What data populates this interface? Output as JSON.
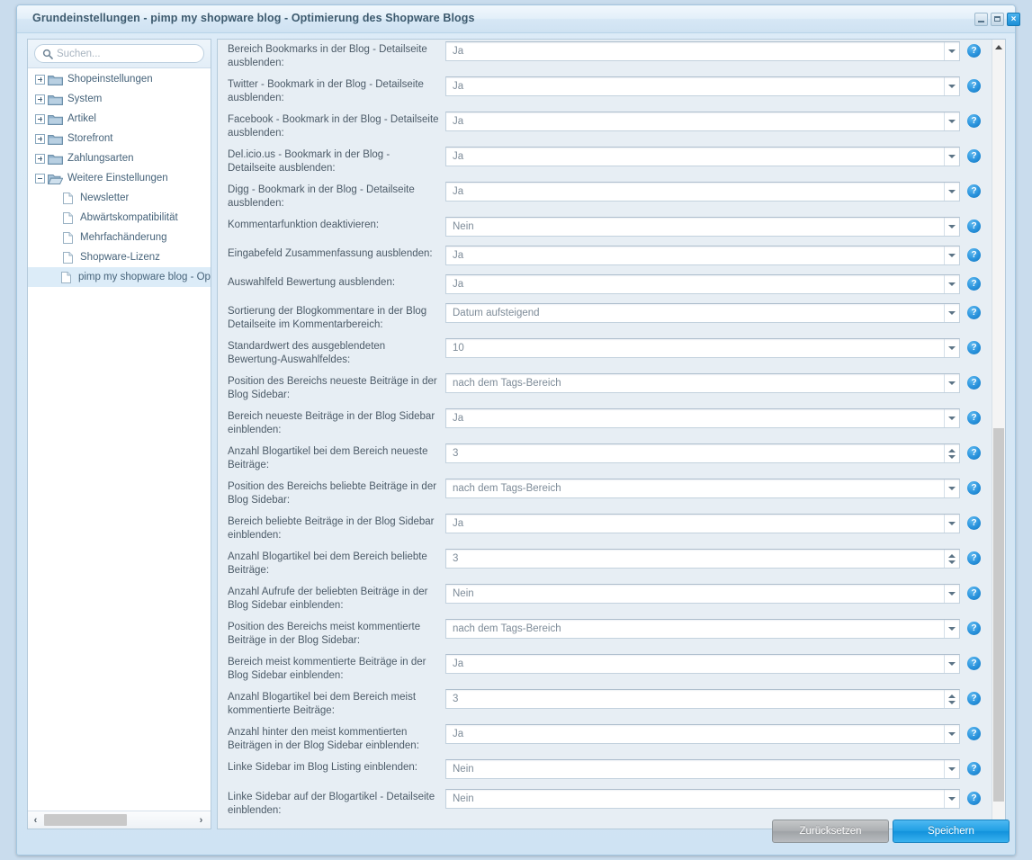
{
  "window": {
    "title": "Grundeinstellungen - pimp my shopware blog - Optimierung des Shopware Blogs",
    "minimize_label": "Minimieren",
    "maximize_label": "Maximieren",
    "close_label": "×",
    "accent_color": "#1b8fd6"
  },
  "sidebar": {
    "search": {
      "placeholder": "Suchen...",
      "value": ""
    },
    "items": [
      {
        "label": "Shopeinstellungen",
        "type": "folder",
        "state": "collapsed",
        "depth": 0,
        "selected": false
      },
      {
        "label": "System",
        "type": "folder",
        "state": "collapsed",
        "depth": 0,
        "selected": false
      },
      {
        "label": "Artikel",
        "type": "folder",
        "state": "collapsed",
        "depth": 0,
        "selected": false
      },
      {
        "label": "Storefront",
        "type": "folder",
        "state": "collapsed",
        "depth": 0,
        "selected": false
      },
      {
        "label": "Zahlungsarten",
        "type": "folder",
        "state": "collapsed",
        "depth": 0,
        "selected": false
      },
      {
        "label": "Weitere Einstellungen",
        "type": "folder-open",
        "state": "expanded",
        "depth": 0,
        "selected": false
      },
      {
        "label": "Newsletter",
        "type": "file",
        "state": "leaf",
        "depth": 1,
        "selected": false
      },
      {
        "label": "Abwärtskompatibilität",
        "type": "file",
        "state": "leaf",
        "depth": 1,
        "selected": false
      },
      {
        "label": "Mehrfachänderung",
        "type": "file",
        "state": "leaf",
        "depth": 1,
        "selected": false
      },
      {
        "label": "Shopware-Lizenz",
        "type": "file",
        "state": "leaf",
        "depth": 1,
        "selected": false
      },
      {
        "label": "pimp my shopware blog - Optim",
        "type": "file",
        "state": "leaf",
        "depth": 1,
        "selected": true
      }
    ],
    "hscroll": {
      "left_arrow": "‹",
      "right_arrow": "›"
    }
  },
  "form": {
    "help_glyph": "?",
    "rows": [
      {
        "label": "Bereich Bookmarks in der Blog - Detailseite ausblenden:",
        "value": "Ja",
        "control": "select"
      },
      {
        "label": "Twitter - Bookmark in der Blog - Detailseite ausblenden:",
        "value": "Ja",
        "control": "select"
      },
      {
        "label": "Facebook - Bookmark in der Blog - Detailseite ausblenden:",
        "value": "Ja",
        "control": "select"
      },
      {
        "label": "Del.icio.us - Bookmark in der Blog - Detailseite ausblenden:",
        "value": "Ja",
        "control": "select"
      },
      {
        "label": "Digg - Bookmark in der Blog - Detailseite ausblenden:",
        "value": "Ja",
        "control": "select"
      },
      {
        "label": "Kommentarfunktion deaktivieren:",
        "value": "Nein",
        "control": "select"
      },
      {
        "label": "Eingabefeld Zusammenfassung ausblenden:",
        "value": "Ja",
        "control": "select"
      },
      {
        "label": "Auswahlfeld Bewertung ausblenden:",
        "value": "Ja",
        "control": "select"
      },
      {
        "label": "Sortierung der Blogkommentare in der Blog Detailseite im Kommentarbereich:",
        "value": "Datum aufsteigend",
        "control": "select"
      },
      {
        "label": "Standardwert des ausgeblendeten Bewertung-Auswahlfeldes:",
        "value": "10",
        "control": "select"
      },
      {
        "label": "Position des Bereichs neueste Beiträge in der Blog Sidebar:",
        "value": "nach dem Tags-Bereich",
        "control": "select"
      },
      {
        "label": "Bereich neueste Beiträge in der Blog Sidebar einblenden:",
        "value": "Ja",
        "control": "select"
      },
      {
        "label": "Anzahl Blogartikel bei dem Bereich neueste Beiträge:",
        "value": "3",
        "control": "spinner"
      },
      {
        "label": "Position des Bereichs beliebte Beiträge in der Blog Sidebar:",
        "value": "nach dem Tags-Bereich",
        "control": "select"
      },
      {
        "label": "Bereich beliebte Beiträge in der Blog Sidebar einblenden:",
        "value": "Ja",
        "control": "select"
      },
      {
        "label": "Anzahl Blogartikel bei dem Bereich beliebte Beiträge:",
        "value": "3",
        "control": "spinner"
      },
      {
        "label": "Anzahl Aufrufe der beliebten Beiträge in der Blog Sidebar einblenden:",
        "value": "Nein",
        "control": "select"
      },
      {
        "label": "Position des Bereichs meist kommentierte Beiträge in der Blog Sidebar:",
        "value": "nach dem Tags-Bereich",
        "control": "select"
      },
      {
        "label": "Bereich meist kommentierte Beiträge in der Blog Sidebar einblenden:",
        "value": "Ja",
        "control": "select"
      },
      {
        "label": "Anzahl Blogartikel bei dem Bereich meist kommentierte Beiträge:",
        "value": "3",
        "control": "spinner"
      },
      {
        "label": "Anzahl hinter den meist kommentierten Beiträgen in der Blog Sidebar einblenden:",
        "value": "Ja",
        "control": "select"
      },
      {
        "label": "Linke Sidebar im Blog Listing einblenden:",
        "value": "Nein",
        "control": "select"
      },
      {
        "label": "Linke Sidebar auf der Blogartikel - Detailseite einblenden:",
        "value": "Nein",
        "control": "select"
      }
    ]
  },
  "footer": {
    "reset_label": "Zurücksetzen",
    "save_label": "Speichern"
  }
}
